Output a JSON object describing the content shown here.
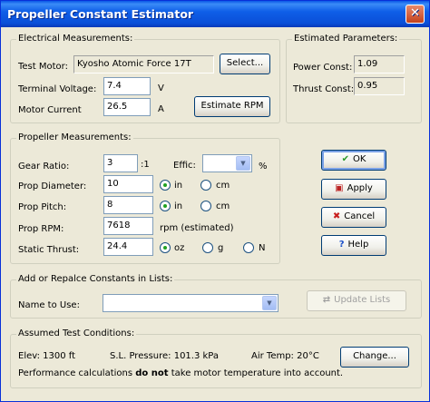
{
  "window": {
    "title": "Propeller Constant Estimator",
    "close_glyph": "✕"
  },
  "electrical": {
    "legend": "Electrical Measurements:",
    "test_motor_label": "Test Motor:",
    "test_motor_value": "Kyosho Atomic Force 17T",
    "select_button": "Select...",
    "terminal_voltage_label": "Terminal Voltage:",
    "terminal_voltage_value": "7.4",
    "terminal_voltage_unit": "V",
    "motor_current_label": "Motor Current",
    "motor_current_value": "26.5",
    "motor_current_unit": "A",
    "estimate_rpm_button": "Estimate RPM"
  },
  "estimated": {
    "legend": "Estimated Parameters:",
    "power_const_label": "Power Const:",
    "power_const_value": "1.09",
    "thrust_const_label": "Thrust Const:",
    "thrust_const_value": "0.95"
  },
  "propeller": {
    "legend": "Propeller Measurements:",
    "gear_ratio_label": "Gear Ratio:",
    "gear_ratio_value": "3",
    "gear_ratio_suffix": ":1",
    "effic_label": "Effic:",
    "effic_value": "",
    "effic_unit": "%",
    "prop_diameter_label": "Prop Diameter:",
    "prop_diameter_value": "10",
    "prop_pitch_label": "Prop Pitch:",
    "prop_pitch_value": "8",
    "prop_rpm_label": "Prop RPM:",
    "prop_rpm_value": "7618",
    "prop_rpm_note": "rpm (estimated)",
    "static_thrust_label": "Static Thrust:",
    "static_thrust_value": "24.4",
    "unit_in": "in",
    "unit_cm": "cm",
    "unit_oz": "oz",
    "unit_g": "g",
    "unit_n": "N"
  },
  "actions": {
    "ok": "OK",
    "apply": "Apply",
    "cancel": "Cancel",
    "help": "Help"
  },
  "constants": {
    "legend": "Add or Repalce Constants in Lists:",
    "name_label": "Name to Use:",
    "name_value": "",
    "update_button": "Update Lists"
  },
  "conditions": {
    "legend": "Assumed Test Conditions:",
    "elev": "Elev: 1300 ft",
    "pressure": "S.L. Pressure: 101.3 kPa",
    "air_temp": "Air Temp: 20°C",
    "change_button": "Change...",
    "note_prefix": "Performance calculations ",
    "note_bold": "do not",
    "note_suffix": " take motor temperature into account."
  }
}
